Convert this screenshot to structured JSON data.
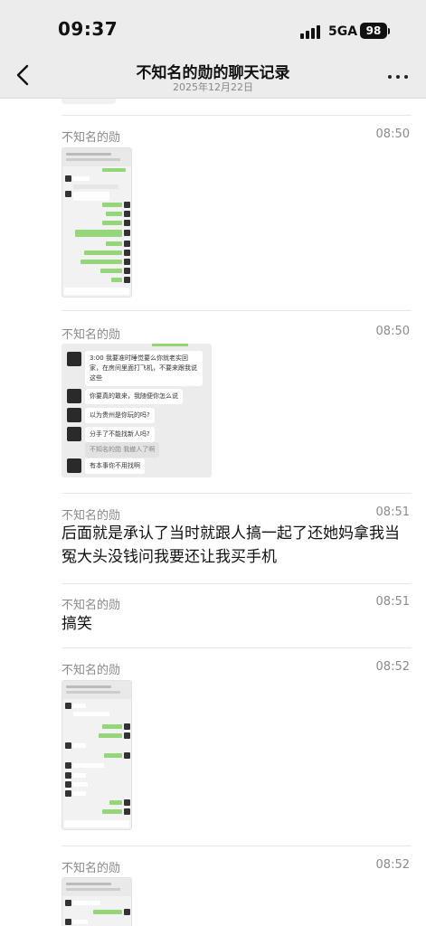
{
  "status_bar": {
    "time": "09:37",
    "network": "5GA",
    "battery": "98"
  },
  "header": {
    "title": "不知名的勋的聊天记录",
    "subtitle": "2025年12月22日"
  },
  "messages": [
    {
      "sender": "不知名的勋",
      "time": "08:50",
      "type": "image"
    },
    {
      "sender": "不知名的勋",
      "time": "08:50",
      "type": "image",
      "image_lines": [
        "3:00 我要准时睡觉要么你就老实回家，在房间里面打飞机，不要来跟我说这些",
        "你要真的敢来，我随便你怎么说",
        "以为贵州是你玩的吗?",
        "分手了不能找新人吗?",
        "不知名的勋  我撤人了啊",
        "有本事你不用找啊"
      ]
    },
    {
      "sender": "不知名的勋",
      "time": "08:51",
      "type": "text",
      "text": "后面就是承认了当时就跟人搞一起了还她妈拿我当冤大头没钱问我要还让我买手机"
    },
    {
      "sender": "不知名的勋",
      "time": "08:51",
      "type": "text",
      "text": "搞笑"
    },
    {
      "sender": "不知名的勋",
      "time": "08:52",
      "type": "image"
    },
    {
      "sender": "不知名的勋",
      "time": "08:52",
      "type": "image"
    }
  ],
  "icons": {
    "back": "chevron-left-icon",
    "more": "more-dots-icon",
    "signal": "signal-icon",
    "battery": "battery-icon"
  },
  "colors": {
    "bar_bg": "#ececec",
    "green_bubble": "#95d67a",
    "meta_text": "#8a8a8a"
  }
}
